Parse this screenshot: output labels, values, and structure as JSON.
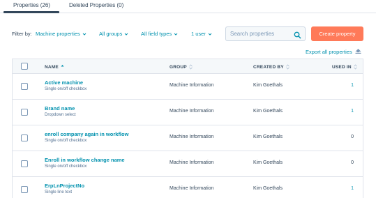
{
  "tabs": [
    {
      "label": "Properties (26)",
      "active": true
    },
    {
      "label": "Deleted Properties (0)",
      "active": false
    }
  ],
  "filters": {
    "label": "Filter by:",
    "dropdowns": [
      "Machine properties",
      "All groups",
      "All field types",
      "1 user"
    ]
  },
  "search": {
    "placeholder": "Search properties",
    "value": ""
  },
  "actions": {
    "create_label": "Create property",
    "export_label": "Export all properties"
  },
  "table": {
    "columns": {
      "name": "NAME",
      "group": "GROUP",
      "created_by": "CREATED BY",
      "used_in": "USED IN"
    },
    "rows": [
      {
        "name": "Active machine",
        "type": "Single on/off checkbox",
        "group": "Machine Information",
        "created_by": "Kim Goethals",
        "used_in": "1"
      },
      {
        "name": "Brand name",
        "type": "Dropdown select",
        "group": "Machine Information",
        "created_by": "Kim Goethals",
        "used_in": "1"
      },
      {
        "name": "enroll company again in workflow",
        "type": "Single on/off checkbox",
        "group": "Machine Information",
        "created_by": "Kim Goethals",
        "used_in": "0"
      },
      {
        "name": "Enroll in workflow change name",
        "type": "Single on/off checkbox",
        "group": "Machine Information",
        "created_by": "Kim Goethals",
        "used_in": "0"
      },
      {
        "name": "ErpLnProjectNo",
        "type": "Single line text",
        "group": "Machine Information",
        "created_by": "Kim Goethals",
        "used_in": "1"
      }
    ]
  },
  "colors": {
    "accent": "#0091ae",
    "primary_button": "#ff7a59",
    "text": "#33475b",
    "border": "#dfe3eb"
  },
  "icons": {
    "search": "search-icon",
    "export": "export-icon",
    "dropdown": "chevron-down-icon",
    "sort": "sort-icon"
  }
}
